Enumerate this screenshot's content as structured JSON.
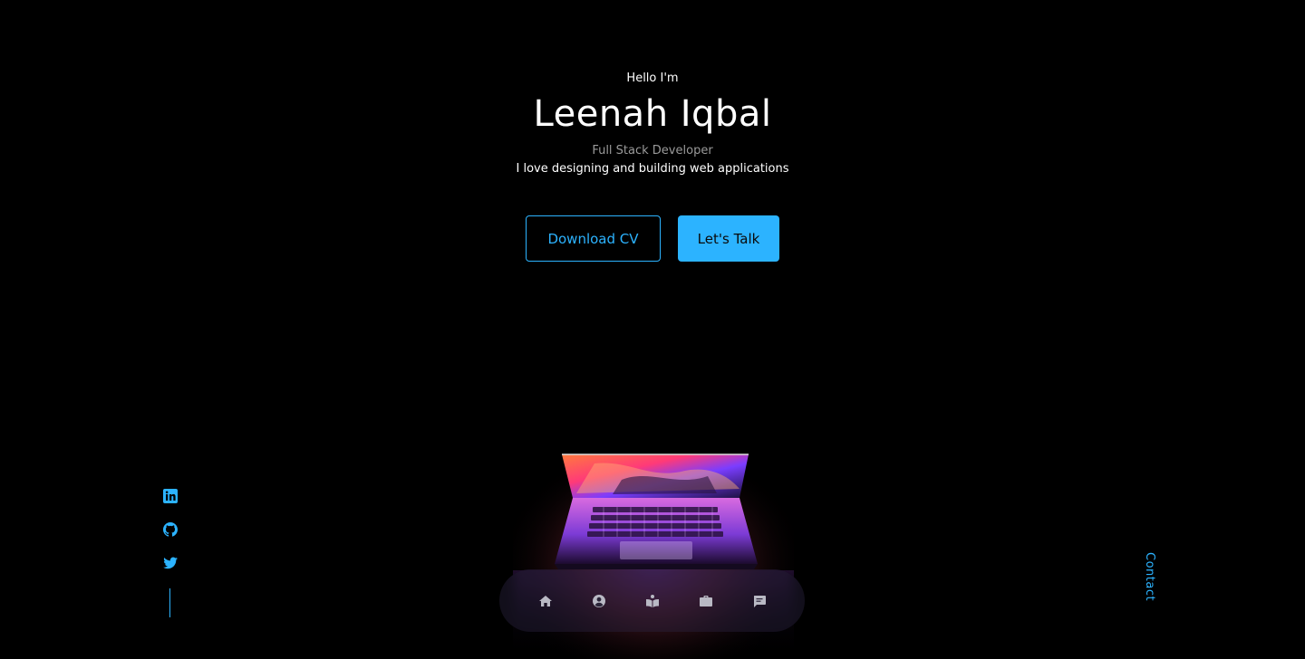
{
  "hero": {
    "greeting": "Hello I'm",
    "name": "Leenah Iqbal",
    "role": "Full Stack Developer",
    "tagline": "I love designing and building web applications"
  },
  "buttons": {
    "download_cv": "Download CV",
    "lets_talk": "Let's Talk"
  },
  "socials": [
    {
      "icon": "linkedin-icon"
    },
    {
      "icon": "github-icon"
    },
    {
      "icon": "twitter-icon"
    }
  ],
  "contact_link": "Contact",
  "bottom_nav": [
    {
      "icon": "home-icon"
    },
    {
      "icon": "user-icon"
    },
    {
      "icon": "book-icon"
    },
    {
      "icon": "briefcase-icon"
    },
    {
      "icon": "message-icon"
    }
  ],
  "colors": {
    "background": "#000000",
    "accent": "#2cb3ff",
    "muted_text": "#9a9a9a"
  }
}
